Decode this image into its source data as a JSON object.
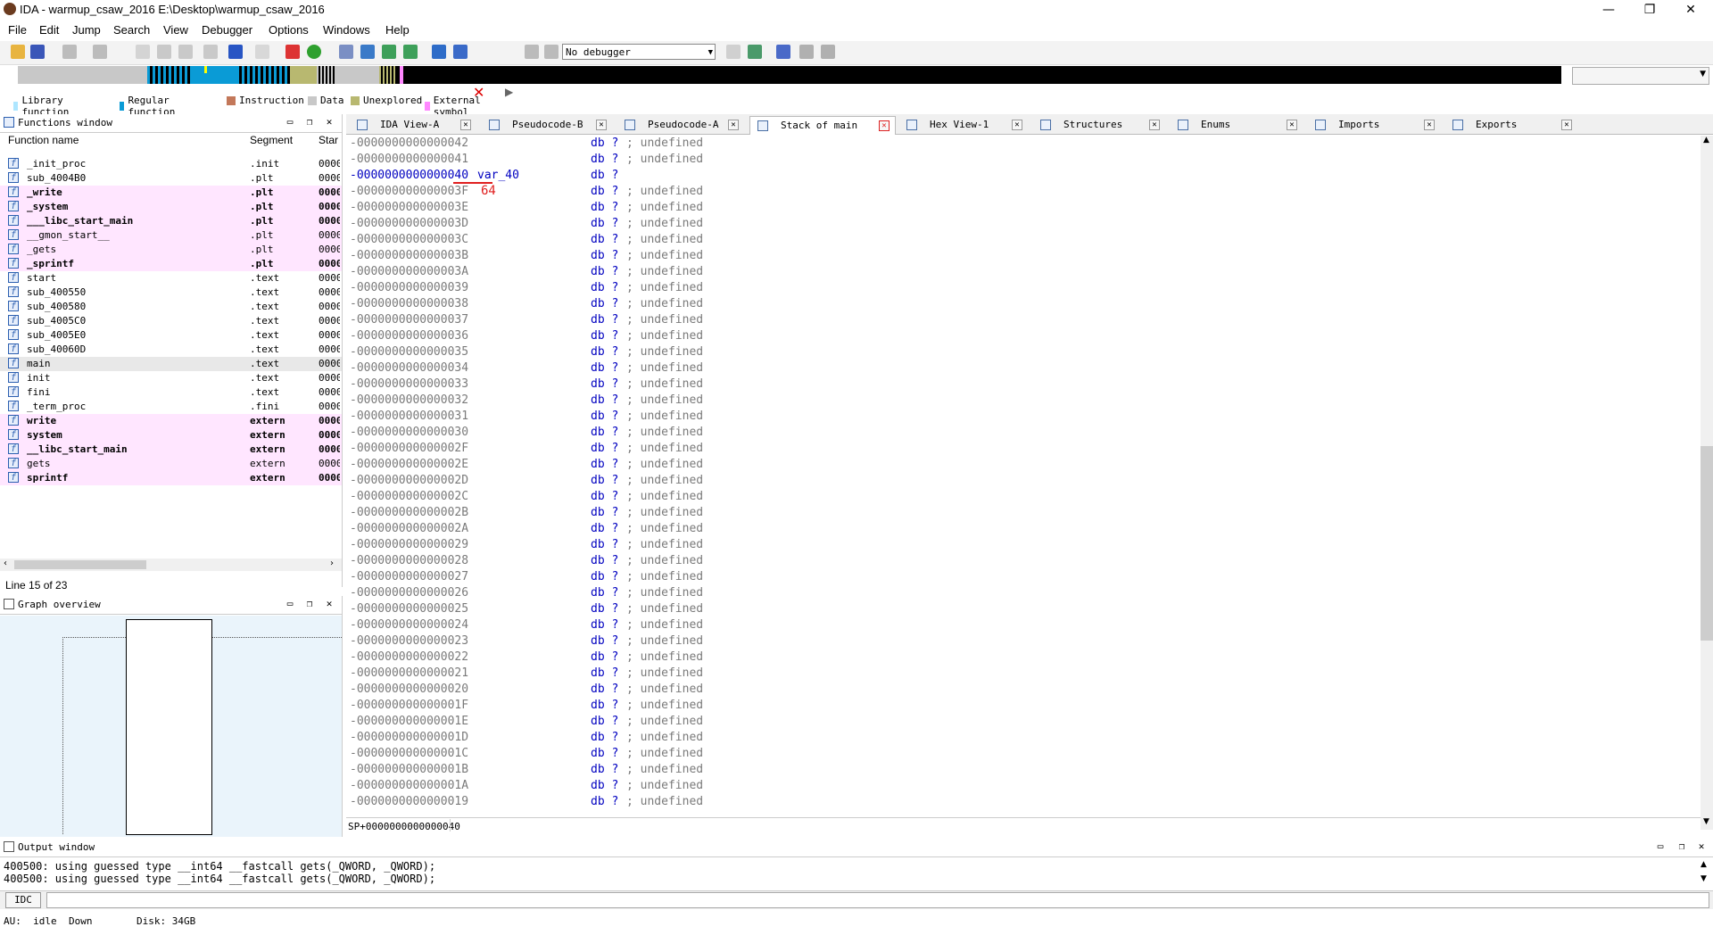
{
  "window": {
    "title": "IDA - warmup_csaw_2016 E:\\Desktop\\warmup_csaw_2016",
    "minimize": "—",
    "restore": "❐",
    "close": "✕"
  },
  "menu": [
    "File",
    "Edit",
    "Jump",
    "Search",
    "View",
    "Debugger",
    "Options",
    "Windows",
    "Help"
  ],
  "toolbar": {
    "debugger_select": "No debugger"
  },
  "legend": [
    {
      "label": "Library function",
      "color": "#aee6ff"
    },
    {
      "label": "Regular function",
      "color": "#0a9bd6"
    },
    {
      "label": "Instruction",
      "color": "#c3785a"
    },
    {
      "label": "Data",
      "color": "#c8c8c8"
    },
    {
      "label": "Unexplored",
      "color": "#b8b870"
    },
    {
      "label": "External symbol",
      "color": "#ff88ff"
    }
  ],
  "functions_window": {
    "title": "Functions window",
    "columns": [
      "Function name",
      "Segment",
      "Star"
    ],
    "rows": [
      {
        "name": "_init_proc",
        "segment": ".init",
        "start": "0000",
        "pink": false,
        "bold": false
      },
      {
        "name": "sub_4004B0",
        "segment": ".plt",
        "start": "0000",
        "pink": false,
        "bold": false
      },
      {
        "name": "_write",
        "segment": ".plt",
        "start": "0000",
        "pink": true,
        "bold": true
      },
      {
        "name": "_system",
        "segment": ".plt",
        "start": "0000",
        "pink": true,
        "bold": true
      },
      {
        "name": "___libc_start_main",
        "segment": ".plt",
        "start": "0000",
        "pink": true,
        "bold": true
      },
      {
        "name": "__gmon_start__",
        "segment": ".plt",
        "start": "0000",
        "pink": true,
        "bold": false
      },
      {
        "name": "_gets",
        "segment": ".plt",
        "start": "0000",
        "pink": true,
        "bold": false
      },
      {
        "name": "_sprintf",
        "segment": ".plt",
        "start": "0000",
        "pink": true,
        "bold": true
      },
      {
        "name": "start",
        "segment": ".text",
        "start": "0000",
        "pink": false,
        "bold": false
      },
      {
        "name": "sub_400550",
        "segment": ".text",
        "start": "0000",
        "pink": false,
        "bold": false
      },
      {
        "name": "sub_400580",
        "segment": ".text",
        "start": "0000",
        "pink": false,
        "bold": false
      },
      {
        "name": "sub_4005C0",
        "segment": ".text",
        "start": "0000",
        "pink": false,
        "bold": false
      },
      {
        "name": "sub_4005E0",
        "segment": ".text",
        "start": "0000",
        "pink": false,
        "bold": false
      },
      {
        "name": "sub_40060D",
        "segment": ".text",
        "start": "0000",
        "pink": false,
        "bold": false
      },
      {
        "name": "main",
        "segment": ".text",
        "start": "0000",
        "pink": false,
        "bold": false,
        "selected": true
      },
      {
        "name": "init",
        "segment": ".text",
        "start": "0000",
        "pink": false,
        "bold": false
      },
      {
        "name": "fini",
        "segment": ".text",
        "start": "0000",
        "pink": false,
        "bold": false
      },
      {
        "name": "_term_proc",
        "segment": ".fini",
        "start": "0000",
        "pink": false,
        "bold": false
      },
      {
        "name": "write",
        "segment": "extern",
        "start": "0000",
        "pink": true,
        "bold": true
      },
      {
        "name": "system",
        "segment": "extern",
        "start": "0000",
        "pink": true,
        "bold": true
      },
      {
        "name": "__libc_start_main",
        "segment": "extern",
        "start": "0000",
        "pink": true,
        "bold": true
      },
      {
        "name": "gets",
        "segment": "extern",
        "start": "0000",
        "pink": true,
        "bold": false
      },
      {
        "name": "sprintf",
        "segment": "extern",
        "start": "0000",
        "pink": true,
        "bold": true
      }
    ],
    "line_status": "Line 15 of 23"
  },
  "graph_overview": {
    "title": "Graph overview"
  },
  "tabs": [
    {
      "label": "IDA View-A",
      "active": false,
      "close_red": false
    },
    {
      "label": "Pseudocode-B",
      "active": false,
      "close_red": false
    },
    {
      "label": "Pseudocode-A",
      "active": false,
      "close_red": false
    },
    {
      "label": "Stack of main",
      "active": true,
      "close_red": true
    },
    {
      "label": "Hex View-1",
      "active": false,
      "close_red": false
    },
    {
      "label": "Structures",
      "active": false,
      "close_red": false
    },
    {
      "label": "Enums",
      "active": false,
      "close_red": false
    },
    {
      "label": "Imports",
      "active": false,
      "close_red": false
    },
    {
      "label": "Exports",
      "active": false,
      "close_red": false
    }
  ],
  "stack": {
    "rows": [
      {
        "addr": "-0000000000000042",
        "db": "db ?",
        "comment": "; undefined"
      },
      {
        "addr": "-0000000000000041",
        "db": "db ?",
        "comment": "; undefined"
      },
      {
        "addr": "-0000000000000040",
        "var": "var_40",
        "db": "db ?",
        "comment": "",
        "highlight": true
      },
      {
        "addr": "-000000000000003F",
        "db": "db ?",
        "comment": "; undefined"
      },
      {
        "addr": "-000000000000003E",
        "db": "db ?",
        "comment": "; undefined"
      },
      {
        "addr": "-000000000000003D",
        "db": "db ?",
        "comment": "; undefined"
      },
      {
        "addr": "-000000000000003C",
        "db": "db ?",
        "comment": "; undefined"
      },
      {
        "addr": "-000000000000003B",
        "db": "db ?",
        "comment": "; undefined"
      },
      {
        "addr": "-000000000000003A",
        "db": "db ?",
        "comment": "; undefined"
      },
      {
        "addr": "-0000000000000039",
        "db": "db ?",
        "comment": "; undefined"
      },
      {
        "addr": "-0000000000000038",
        "db": "db ?",
        "comment": "; undefined"
      },
      {
        "addr": "-0000000000000037",
        "db": "db ?",
        "comment": "; undefined"
      },
      {
        "addr": "-0000000000000036",
        "db": "db ?",
        "comment": "; undefined"
      },
      {
        "addr": "-0000000000000035",
        "db": "db ?",
        "comment": "; undefined"
      },
      {
        "addr": "-0000000000000034",
        "db": "db ?",
        "comment": "; undefined"
      },
      {
        "addr": "-0000000000000033",
        "db": "db ?",
        "comment": "; undefined"
      },
      {
        "addr": "-0000000000000032",
        "db": "db ?",
        "comment": "; undefined"
      },
      {
        "addr": "-0000000000000031",
        "db": "db ?",
        "comment": "; undefined"
      },
      {
        "addr": "-0000000000000030",
        "db": "db ?",
        "comment": "; undefined"
      },
      {
        "addr": "-000000000000002F",
        "db": "db ?",
        "comment": "; undefined"
      },
      {
        "addr": "-000000000000002E",
        "db": "db ?",
        "comment": "; undefined"
      },
      {
        "addr": "-000000000000002D",
        "db": "db ?",
        "comment": "; undefined"
      },
      {
        "addr": "-000000000000002C",
        "db": "db ?",
        "comment": "; undefined"
      },
      {
        "addr": "-000000000000002B",
        "db": "db ?",
        "comment": "; undefined"
      },
      {
        "addr": "-000000000000002A",
        "db": "db ?",
        "comment": "; undefined"
      },
      {
        "addr": "-0000000000000029",
        "db": "db ?",
        "comment": "; undefined"
      },
      {
        "addr": "-0000000000000028",
        "db": "db ?",
        "comment": "; undefined"
      },
      {
        "addr": "-0000000000000027",
        "db": "db ?",
        "comment": "; undefined"
      },
      {
        "addr": "-0000000000000026",
        "db": "db ?",
        "comment": "; undefined"
      },
      {
        "addr": "-0000000000000025",
        "db": "db ?",
        "comment": "; undefined"
      },
      {
        "addr": "-0000000000000024",
        "db": "db ?",
        "comment": "; undefined"
      },
      {
        "addr": "-0000000000000023",
        "db": "db ?",
        "comment": "; undefined"
      },
      {
        "addr": "-0000000000000022",
        "db": "db ?",
        "comment": "; undefined"
      },
      {
        "addr": "-0000000000000021",
        "db": "db ?",
        "comment": "; undefined"
      },
      {
        "addr": "-0000000000000020",
        "db": "db ?",
        "comment": "; undefined"
      },
      {
        "addr": "-000000000000001F",
        "db": "db ?",
        "comment": "; undefined"
      },
      {
        "addr": "-000000000000001E",
        "db": "db ?",
        "comment": "; undefined"
      },
      {
        "addr": "-000000000000001D",
        "db": "db ?",
        "comment": "; undefined"
      },
      {
        "addr": "-000000000000001C",
        "db": "db ?",
        "comment": "; undefined"
      },
      {
        "addr": "-000000000000001B",
        "db": "db ?",
        "comment": "; undefined"
      },
      {
        "addr": "-000000000000001A",
        "db": "db ?",
        "comment": "; undefined"
      },
      {
        "addr": "-0000000000000019",
        "db": "db ?",
        "comment": "; undefined"
      }
    ],
    "annotation": "64",
    "sp_status": "SP+0000000000000040"
  },
  "output_window": {
    "title": "Output window",
    "lines": [
      "400500: using guessed type __int64 __fastcall gets(_QWORD, _QWORD);",
      "400500: using guessed type __int64 __fastcall gets(_QWORD, _QWORD);"
    ],
    "idc_label": "IDC"
  },
  "statusbar": {
    "au": "AU:  idle",
    "dir": "Down",
    "disk": "Disk: 34GB"
  }
}
